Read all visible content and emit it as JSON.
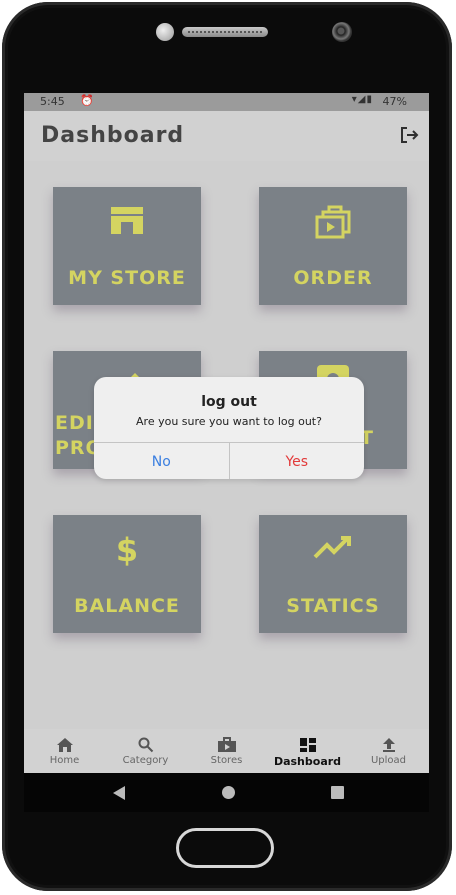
{
  "status": {
    "time": "5:45",
    "battery": "47%"
  },
  "appbar": {
    "title": "Dashboard"
  },
  "cards": [
    {
      "label": "MY STORE",
      "icon": "store-icon"
    },
    {
      "label": "ORDER",
      "icon": "order-icon"
    },
    {
      "label": "EDIT PROFILE",
      "label_line1": "EDI",
      "label_line2": "PRO",
      "icon": "pencil-icon"
    },
    {
      "label": "SETTINGS",
      "label_line1": "T",
      "icon": "settings-icon"
    },
    {
      "label": "BALANCE",
      "icon": "dollar-icon"
    },
    {
      "label": "STATICS",
      "icon": "trending-icon"
    }
  ],
  "dialog": {
    "title": "log out",
    "message": "Are you sure you want to log out?",
    "no": "No",
    "yes": "Yes"
  },
  "nav": [
    {
      "label": "Home",
      "icon": "home-icon"
    },
    {
      "label": "Category",
      "icon": "search-icon"
    },
    {
      "label": "Stores",
      "icon": "stores-icon"
    },
    {
      "label": "Dashboard",
      "icon": "dashboard-icon",
      "active": true
    },
    {
      "label": "Upload",
      "icon": "upload-icon"
    }
  ],
  "colors": {
    "card": "#6d747c",
    "card_text": "#d9d94e",
    "no": "#3b7fe0",
    "yes": "#e23a3a"
  }
}
